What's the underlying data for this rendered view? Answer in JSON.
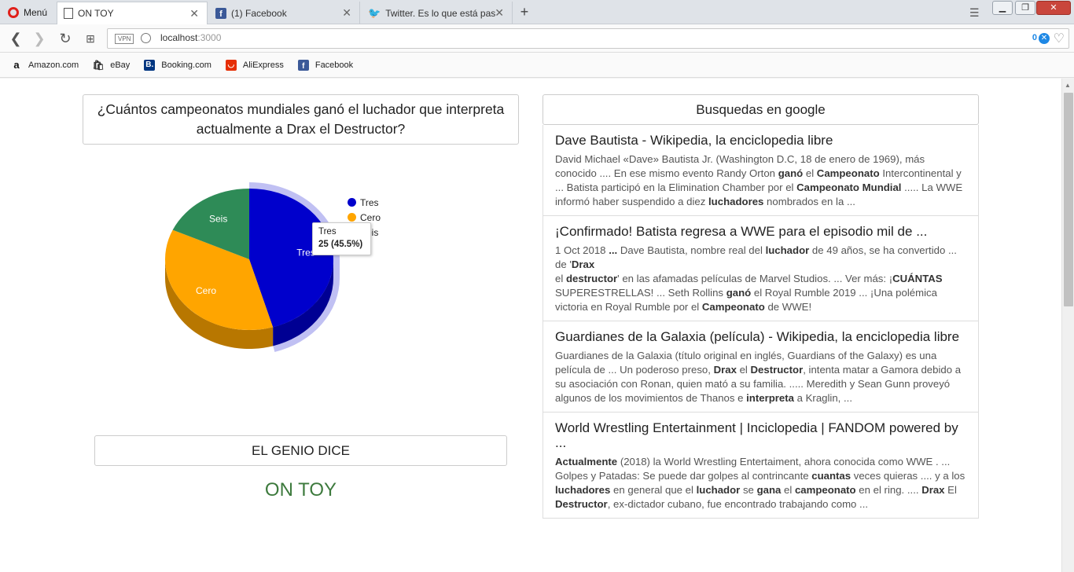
{
  "browser": {
    "menu_label": "Menú",
    "tabs": [
      {
        "label": "ON TOY",
        "icon": "page-icon",
        "active": true
      },
      {
        "label": "(1) Facebook",
        "icon": "facebook-icon",
        "active": false
      },
      {
        "label": "Twitter. Es lo que está pasan",
        "icon": "twitter-icon",
        "active": false
      }
    ],
    "address": {
      "vpn": "VPN",
      "host": "localhost",
      "port": ":3000",
      "counter": "0"
    },
    "bookmarks": [
      {
        "label": "Amazon.com",
        "icon": "amazon-icon"
      },
      {
        "label": "eBay",
        "icon": "ebay-icon"
      },
      {
        "label": "Booking.com",
        "icon": "booking-icon"
      },
      {
        "label": "AliExpress",
        "icon": "aliexpress-icon"
      },
      {
        "label": "Facebook",
        "icon": "facebook-icon"
      }
    ]
  },
  "question": {
    "text": "¿Cuántos campeonatos mundiales ganó el luchador que interpreta actualmente a Drax el Destructor?"
  },
  "chart_data": {
    "type": "pie",
    "title": "",
    "categories": [
      "Tres",
      "Cero",
      "Seis"
    ],
    "values": [
      25,
      20,
      10
    ],
    "percentages": [
      45.5,
      36.4,
      18.2
    ],
    "colors": [
      "#0000cc",
      "#ffa500",
      "#2e8b57"
    ],
    "legend_position": "right",
    "tooltip": {
      "label": "Tres",
      "value": "25 (45.5%)"
    }
  },
  "genio": {
    "title": "EL GENIO DICE",
    "answer": "ON TOY"
  },
  "search": {
    "title": "Busquedas en google",
    "results": [
      {
        "title": "Dave Bautista - Wikipedia, la enciclopedia libre",
        "snippet": "David Michael «Dave» Bautista Jr. (Washington D.C, 18 de enero de 1969), más conocido .... En ese mismo evento Randy Orton <b>ganó</b> el <b>Campeonato</b> Intercontinental y ... Batista participó en la Elimination Chamber por el <b>Campeonato Mundial</b> ..... La WWE informó haber suspendido a diez <b>luchadores</b> nombrados en la ..."
      },
      {
        "title": "¡Confirmado! Batista regresa a WWE para el episodio mil de ...",
        "snippet": "1 Oct 2018 <b>...</b> Dave Bautista, nombre real del <b>luchador</b> de 49 años, se ha convertido ... de '<b>Drax</b><br>el <b>destructor</b>' en las afamadas películas de Marvel Studios. ... Ver más: ¡<b>CUÁNTAS</b> SUPERESTRELLAS! ... Seth Rollins <b>ganó</b> el Royal Rumble 2019 ... ¡Una polémica victoria en Royal Rumble por el <b>Campeonato</b> de WWE!"
      },
      {
        "title": "Guardianes de la Galaxia (película) - Wikipedia, la enciclopedia libre",
        "snippet": "Guardianes de la Galaxia (título original en inglés, Guardians of the Galaxy) es una película de ... Un poderoso preso, <b>Drax</b> el <b>Destructor</b>, intenta matar a Gamora debido a su asociación con Ronan, quien mató a su familia. ..... Meredith y Sean Gunn proveyó algunos de los movimientos de Thanos e <b>interpreta</b> a Kraglin, ..."
      },
      {
        "title": "World Wrestling Entertainment | Inciclopedia | FANDOM powered by ...",
        "snippet": "<b>Actualmente</b> (2018) la World Wrestling Entertaiment, ahora conocida como WWE . ... Golpes y Patadas: Se puede dar golpes al contrincante <b>cuantas</b> veces quieras .... y a los <b>luchadores</b> en general que el <b>luchador</b> se <b>gana</b> el <b>campeonato</b> en el ring. .... <b>Drax</b> El <b>Destructor</b>, ex-dictador cubano, fue encontrado trabajando como ..."
      }
    ]
  }
}
